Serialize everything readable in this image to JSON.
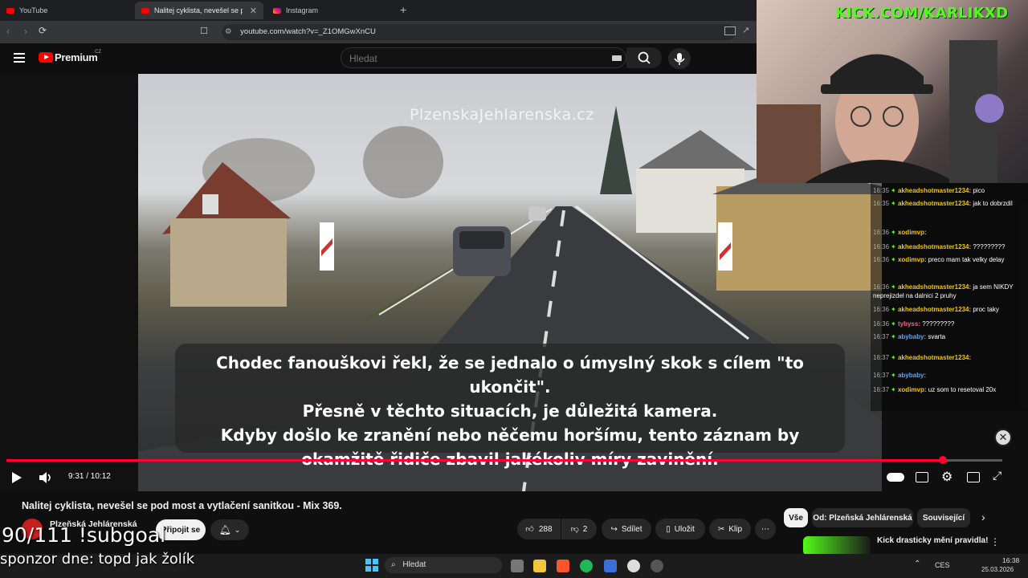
{
  "browser": {
    "tabs": [
      {
        "label": "YouTube",
        "active": false
      },
      {
        "label": "Nalitej cyklista, nevešel se pod",
        "active": true
      },
      {
        "label": "Instagram",
        "active": false
      }
    ],
    "url": "youtube.com/watch?v=_Z1OMGwXnCU"
  },
  "youtube": {
    "logo_text": "Premium",
    "logo_region": "CZ",
    "search_placeholder": "Hledat"
  },
  "video": {
    "watermark": "PlzenskaJehlarenska.cz",
    "caption_lines": [
      "Chodec fanouškovi řekl, že se jednalo o úmyslný skok s cílem \"to ukončit\".",
      "Přesně v těchto situacích, je důležitá kamera.",
      "Kdyby došlo ke zranění nebo něčemu horšímu, tento záznam by",
      "okamžitě řidiče zbavil jakékoliv míry zavinění."
    ],
    "time_current": "9:31",
    "time_total": "10:12",
    "time_display": "9:31 / 10:12",
    "progress_fraction": 0.94
  },
  "details": {
    "title": "Nalitej cyklista, nevešel se pod most a vytlačení sanitkou - Mix 369.",
    "channel": "Plzeňská Jehlárenská",
    "subscribe_label": "Připojit se",
    "likes": "288",
    "dislikes": "2",
    "share_label": "Sdílet",
    "save_label": "Uložit",
    "clip_label": "Klip",
    "chips": [
      "Vše",
      "Od: Plzeňská Jehlárenská",
      "Související"
    ],
    "rec_title": "Kick drasticky mění pravidla!"
  },
  "stream": {
    "kick_url": "KICK.COM/KARLIKXD",
    "subgoal": "90/111 !subgoal",
    "sponsor": "sponzor dne: topd jak žolík",
    "chat": [
      {
        "time": "16:35",
        "user": "akheadshotmaster1234:",
        "text": "pico",
        "color": "#f0c419"
      },
      {
        "time": "16:35",
        "user": "akheadshotmaster1234:",
        "text": "jak to dobrzdil",
        "color": "#f0c419"
      },
      {
        "time": "16:36",
        "user": "xodimvp:",
        "text": "",
        "color": "#f0c419"
      },
      {
        "time": "16:36",
        "user": "akheadshotmaster1234:",
        "text": "?????????",
        "color": "#f0c419"
      },
      {
        "time": "16:36",
        "user": "xodimvp:",
        "text": "preco mam tak velky delay",
        "color": "#f0c419"
      },
      {
        "time": "16:36",
        "user": "akheadshotmaster1234:",
        "text": "ja sem NIKDY neprejizdel na dalnici 2 pruhy",
        "color": "#f0c419"
      },
      {
        "time": "16:36",
        "user": "akheadshotmaster1234:",
        "text": "proc taky",
        "color": "#f0c419"
      },
      {
        "time": "16:36",
        "user": "tybyss:",
        "text": "?????????",
        "color": "#ff5b8a"
      },
      {
        "time": "16:37",
        "user": "abybaby:",
        "text": "svarta",
        "color": "#5aa7ff"
      },
      {
        "time": "16:37",
        "user": "akheadshotmaster1234:",
        "text": "",
        "color": "#f0c419"
      },
      {
        "time": "16:37",
        "user": "abybaby:",
        "text": "",
        "color": "#5aa7ff"
      },
      {
        "time": "16:37",
        "user": "xodimvp:",
        "text": "uz som to resetoval 20x",
        "color": "#f0c419"
      }
    ]
  },
  "taskbar": {
    "search_label": "Hledat",
    "lang": "CES",
    "time": "16:38",
    "date": "25.03.2026"
  }
}
